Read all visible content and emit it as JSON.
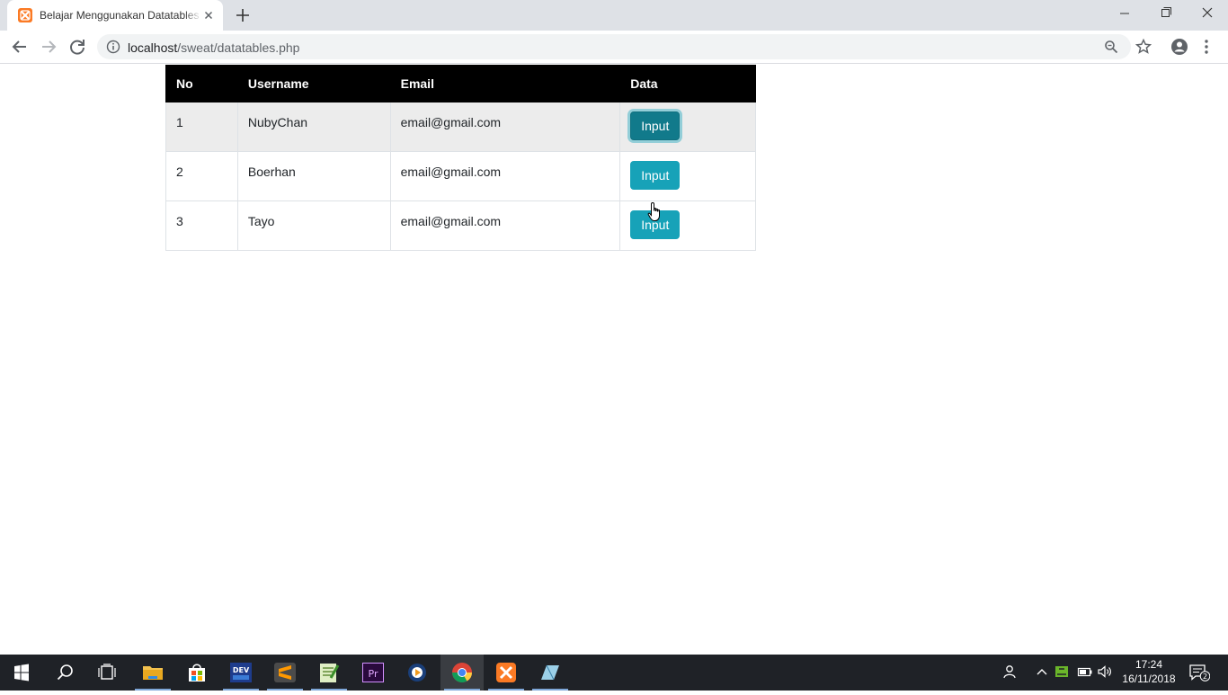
{
  "browser": {
    "tab_title": "Belajar Menggunakan Datatables",
    "url_host": "localhost",
    "url_path": "/sweat/datatables.php"
  },
  "table": {
    "headers": [
      "No",
      "Username",
      "Email",
      "Data"
    ],
    "rows": [
      {
        "no": "1",
        "username": "NubyChan",
        "email": "email@gmail.com",
        "button": "Input"
      },
      {
        "no": "2",
        "username": "Boerhan",
        "email": "email@gmail.com",
        "button": "Input"
      },
      {
        "no": "3",
        "username": "Tayo",
        "email": "email@gmail.com",
        "button": "Input"
      }
    ]
  },
  "taskbar": {
    "apps": [
      "start-icon",
      "search-icon",
      "task-view-icon",
      "file-explorer-icon",
      "store-icon",
      "devcpp-icon",
      "sublime-text-icon",
      "notepad-icon",
      "premiere-pro-icon",
      "media-player-icon",
      "chrome-icon",
      "xampp-icon",
      "virtualbox-icon"
    ],
    "time": "17:24",
    "date": "16/11/2018",
    "notification_count": "2"
  },
  "colors": {
    "button_info": "#17a2b8",
    "button_active": "#117a8b",
    "table_header": "#000000",
    "taskbar": "#1f2227"
  }
}
